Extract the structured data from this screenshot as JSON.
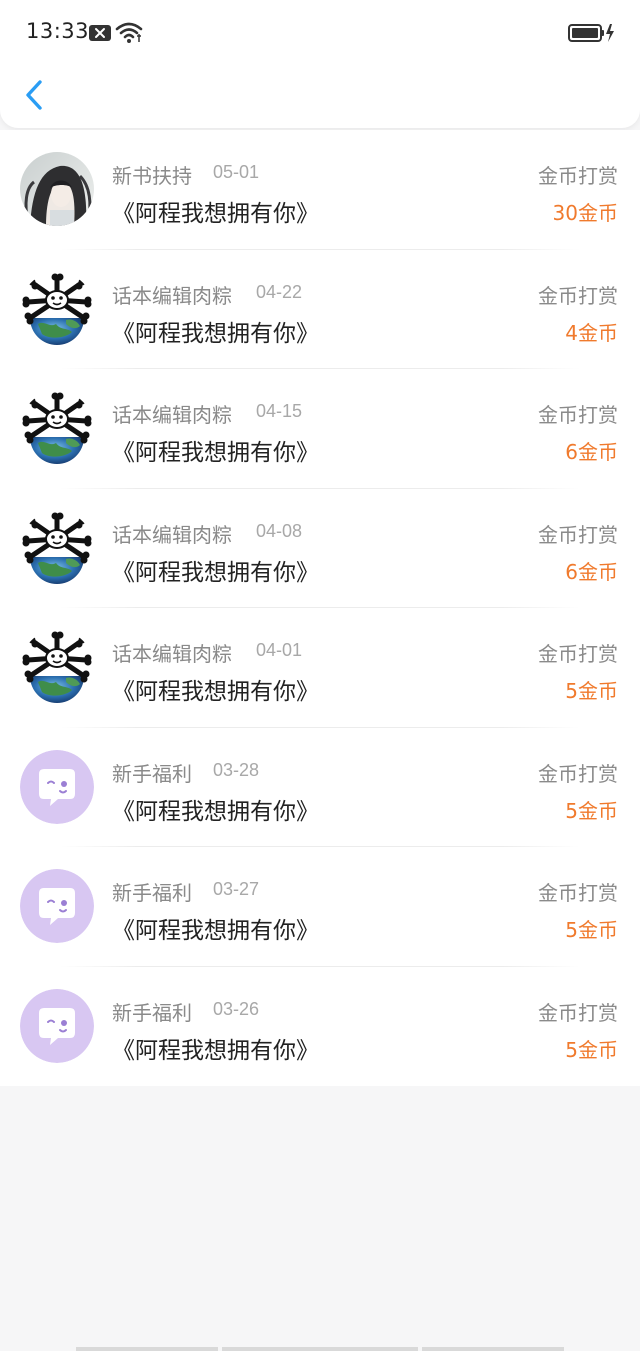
{
  "status_bar": {
    "time": "13:33",
    "icons": [
      "notification-x-icon",
      "wifi-icon",
      "battery-charging-icon"
    ]
  },
  "nav": {
    "back_icon": "chevron-left-icon",
    "accent_color": "#2a9df4"
  },
  "colors": {
    "amount": "#f07a2d",
    "secondary_text": "#8a8a8a",
    "primary_text": "#222222"
  },
  "records": [
    {
      "sender": "新书扶持",
      "date": "05-01",
      "book": "《阿程我想拥有你》",
      "type": "金币打赏",
      "amount": "30金币",
      "avatar": "character-portrait"
    },
    {
      "sender": "话本编辑肉粽",
      "date": "04-22",
      "book": "《阿程我想拥有你》",
      "type": "金币打赏",
      "amount": "4金币",
      "avatar": "earth-bones"
    },
    {
      "sender": "话本编辑肉粽",
      "date": "04-15",
      "book": "《阿程我想拥有你》",
      "type": "金币打赏",
      "amount": "6金币",
      "avatar": "earth-bones"
    },
    {
      "sender": "话本编辑肉粽",
      "date": "04-08",
      "book": "《阿程我想拥有你》",
      "type": "金币打赏",
      "amount": "6金币",
      "avatar": "earth-bones"
    },
    {
      "sender": "话本编辑肉粽",
      "date": "04-01",
      "book": "《阿程我想拥有你》",
      "type": "金币打赏",
      "amount": "5金币",
      "avatar": "earth-bones"
    },
    {
      "sender": "新手福利",
      "date": "03-28",
      "book": "《阿程我想拥有你》",
      "type": "金币打赏",
      "amount": "5金币",
      "avatar": "chat-bubble"
    },
    {
      "sender": "新手福利",
      "date": "03-27",
      "book": "《阿程我想拥有你》",
      "type": "金币打赏",
      "amount": "5金币",
      "avatar": "chat-bubble"
    },
    {
      "sender": "新手福利",
      "date": "03-26",
      "book": "《阿程我想拥有你》",
      "type": "金币打赏",
      "amount": "5金币",
      "avatar": "chat-bubble"
    }
  ]
}
